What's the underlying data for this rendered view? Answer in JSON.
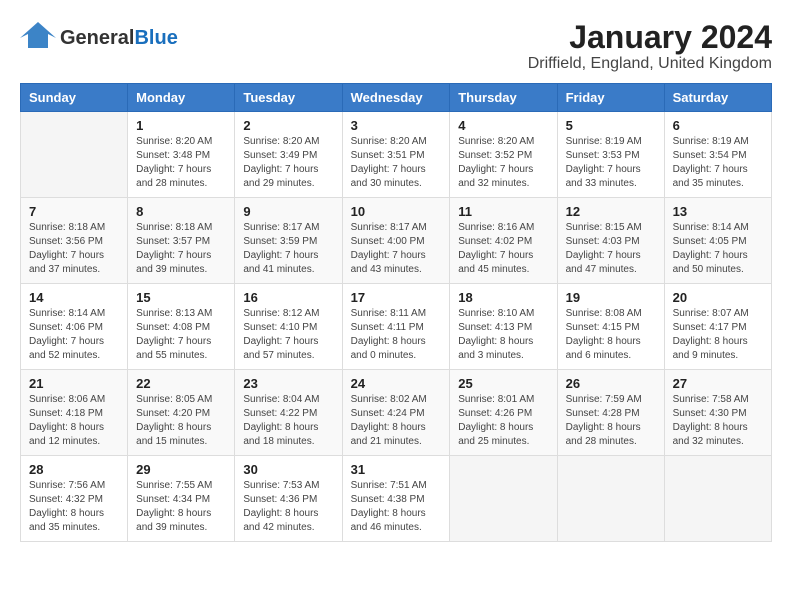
{
  "logo": {
    "general": "General",
    "blue": "Blue"
  },
  "title": "January 2024",
  "location": "Driffield, England, United Kingdom",
  "headers": [
    "Sunday",
    "Monday",
    "Tuesday",
    "Wednesday",
    "Thursday",
    "Friday",
    "Saturday"
  ],
  "weeks": [
    [
      {
        "day": "",
        "info": ""
      },
      {
        "day": "1",
        "info": "Sunrise: 8:20 AM\nSunset: 3:48 PM\nDaylight: 7 hours\nand 28 minutes."
      },
      {
        "day": "2",
        "info": "Sunrise: 8:20 AM\nSunset: 3:49 PM\nDaylight: 7 hours\nand 29 minutes."
      },
      {
        "day": "3",
        "info": "Sunrise: 8:20 AM\nSunset: 3:51 PM\nDaylight: 7 hours\nand 30 minutes."
      },
      {
        "day": "4",
        "info": "Sunrise: 8:20 AM\nSunset: 3:52 PM\nDaylight: 7 hours\nand 32 minutes."
      },
      {
        "day": "5",
        "info": "Sunrise: 8:19 AM\nSunset: 3:53 PM\nDaylight: 7 hours\nand 33 minutes."
      },
      {
        "day": "6",
        "info": "Sunrise: 8:19 AM\nSunset: 3:54 PM\nDaylight: 7 hours\nand 35 minutes."
      }
    ],
    [
      {
        "day": "7",
        "info": "Sunrise: 8:18 AM\nSunset: 3:56 PM\nDaylight: 7 hours\nand 37 minutes."
      },
      {
        "day": "8",
        "info": "Sunrise: 8:18 AM\nSunset: 3:57 PM\nDaylight: 7 hours\nand 39 minutes."
      },
      {
        "day": "9",
        "info": "Sunrise: 8:17 AM\nSunset: 3:59 PM\nDaylight: 7 hours\nand 41 minutes."
      },
      {
        "day": "10",
        "info": "Sunrise: 8:17 AM\nSunset: 4:00 PM\nDaylight: 7 hours\nand 43 minutes."
      },
      {
        "day": "11",
        "info": "Sunrise: 8:16 AM\nSunset: 4:02 PM\nDaylight: 7 hours\nand 45 minutes."
      },
      {
        "day": "12",
        "info": "Sunrise: 8:15 AM\nSunset: 4:03 PM\nDaylight: 7 hours\nand 47 minutes."
      },
      {
        "day": "13",
        "info": "Sunrise: 8:14 AM\nSunset: 4:05 PM\nDaylight: 7 hours\nand 50 minutes."
      }
    ],
    [
      {
        "day": "14",
        "info": "Sunrise: 8:14 AM\nSunset: 4:06 PM\nDaylight: 7 hours\nand 52 minutes."
      },
      {
        "day": "15",
        "info": "Sunrise: 8:13 AM\nSunset: 4:08 PM\nDaylight: 7 hours\nand 55 minutes."
      },
      {
        "day": "16",
        "info": "Sunrise: 8:12 AM\nSunset: 4:10 PM\nDaylight: 7 hours\nand 57 minutes."
      },
      {
        "day": "17",
        "info": "Sunrise: 8:11 AM\nSunset: 4:11 PM\nDaylight: 8 hours\nand 0 minutes."
      },
      {
        "day": "18",
        "info": "Sunrise: 8:10 AM\nSunset: 4:13 PM\nDaylight: 8 hours\nand 3 minutes."
      },
      {
        "day": "19",
        "info": "Sunrise: 8:08 AM\nSunset: 4:15 PM\nDaylight: 8 hours\nand 6 minutes."
      },
      {
        "day": "20",
        "info": "Sunrise: 8:07 AM\nSunset: 4:17 PM\nDaylight: 8 hours\nand 9 minutes."
      }
    ],
    [
      {
        "day": "21",
        "info": "Sunrise: 8:06 AM\nSunset: 4:18 PM\nDaylight: 8 hours\nand 12 minutes."
      },
      {
        "day": "22",
        "info": "Sunrise: 8:05 AM\nSunset: 4:20 PM\nDaylight: 8 hours\nand 15 minutes."
      },
      {
        "day": "23",
        "info": "Sunrise: 8:04 AM\nSunset: 4:22 PM\nDaylight: 8 hours\nand 18 minutes."
      },
      {
        "day": "24",
        "info": "Sunrise: 8:02 AM\nSunset: 4:24 PM\nDaylight: 8 hours\nand 21 minutes."
      },
      {
        "day": "25",
        "info": "Sunrise: 8:01 AM\nSunset: 4:26 PM\nDaylight: 8 hours\nand 25 minutes."
      },
      {
        "day": "26",
        "info": "Sunrise: 7:59 AM\nSunset: 4:28 PM\nDaylight: 8 hours\nand 28 minutes."
      },
      {
        "day": "27",
        "info": "Sunrise: 7:58 AM\nSunset: 4:30 PM\nDaylight: 8 hours\nand 32 minutes."
      }
    ],
    [
      {
        "day": "28",
        "info": "Sunrise: 7:56 AM\nSunset: 4:32 PM\nDaylight: 8 hours\nand 35 minutes."
      },
      {
        "day": "29",
        "info": "Sunrise: 7:55 AM\nSunset: 4:34 PM\nDaylight: 8 hours\nand 39 minutes."
      },
      {
        "day": "30",
        "info": "Sunrise: 7:53 AM\nSunset: 4:36 PM\nDaylight: 8 hours\nand 42 minutes."
      },
      {
        "day": "31",
        "info": "Sunrise: 7:51 AM\nSunset: 4:38 PM\nDaylight: 8 hours\nand 46 minutes."
      },
      {
        "day": "",
        "info": ""
      },
      {
        "day": "",
        "info": ""
      },
      {
        "day": "",
        "info": ""
      }
    ]
  ]
}
